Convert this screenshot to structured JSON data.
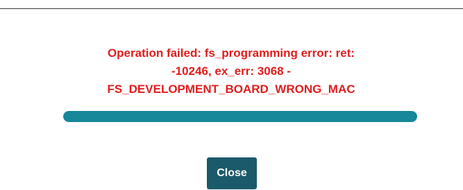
{
  "dialog": {
    "error_lines": [
      "Operation failed: fs_programming error: ret:",
      "-10246, ex_err: 3068 -",
      "FS_DEVELOPMENT_BOARD_WRONG_MAC"
    ],
    "progress_fraction": 1.0,
    "close_label": "Close"
  },
  "colors": {
    "error_text": "#e11d1d",
    "progress_fill": "#17879a",
    "button_bg": "#1b5a6b"
  }
}
